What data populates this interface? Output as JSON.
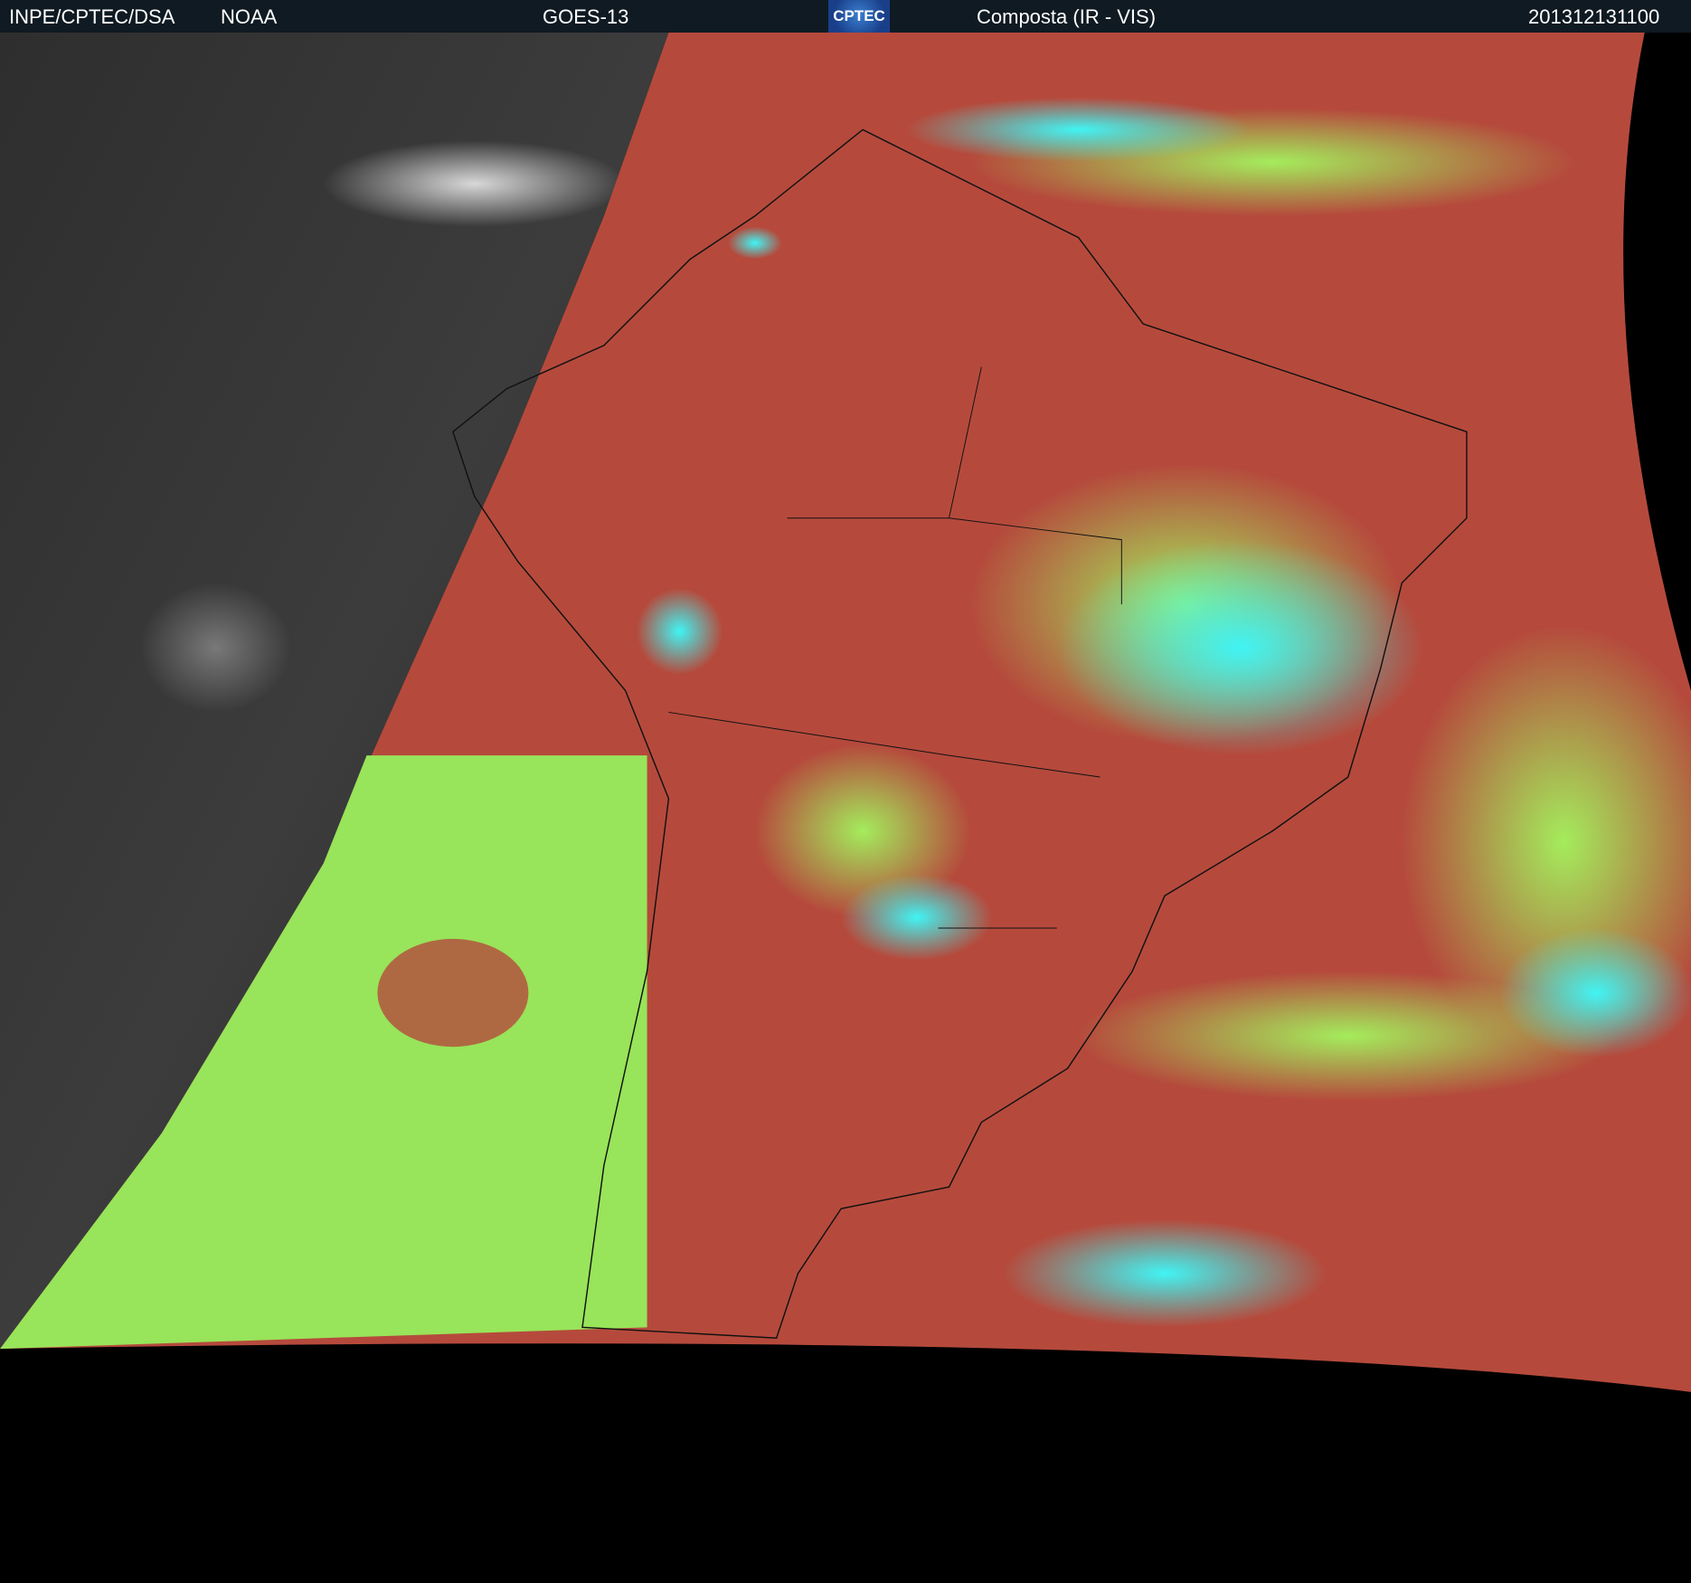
{
  "header": {
    "agency": "INPE/CPTEC/DSA",
    "source": "NOAA",
    "satellite": "GOES-13",
    "logo_text": "CPTEC",
    "product": "Composta (IR - VIS)",
    "timestamp": "201312131100"
  },
  "colors": {
    "header_bg": "#0f1a22",
    "land_red": "#b24a3c",
    "cloud_green": "#9ee85a",
    "cloud_cyan": "#40f0f0",
    "night_gray": "#3a3a3a"
  }
}
